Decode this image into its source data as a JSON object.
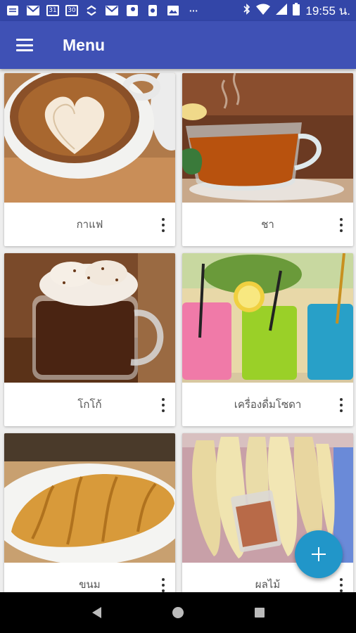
{
  "status_bar": {
    "time": "19:55 น.",
    "icons": [
      "notes-icon",
      "gmail-icon",
      "calendar-icon",
      "calendar-icon",
      "sync-icon",
      "gmail-icon",
      "maps-icon",
      "phone-icon",
      "image-icon",
      "more-icon",
      "bluetooth-icon",
      "wifi-icon",
      "signal-icon",
      "battery-icon"
    ],
    "calendar_a": "31",
    "calendar_b": "30",
    "overflow": "···"
  },
  "app_bar": {
    "title": "Menu",
    "color": "#3f51b5"
  },
  "menu": {
    "items": [
      {
        "label": "กาแฟ",
        "image": "coffee-latte"
      },
      {
        "label": "ชา",
        "image": "tea-cup"
      },
      {
        "label": "โกโก้",
        "image": "cocoa-mug"
      },
      {
        "label": "เครื่องดื่มโซดา",
        "image": "soda-drinks"
      },
      {
        "label": "ขนม",
        "image": "croissant"
      },
      {
        "label": "ผลไม้",
        "image": "fruit-mango"
      }
    ]
  },
  "fab": {
    "icon": "plus-icon",
    "color": "#2196c9"
  }
}
